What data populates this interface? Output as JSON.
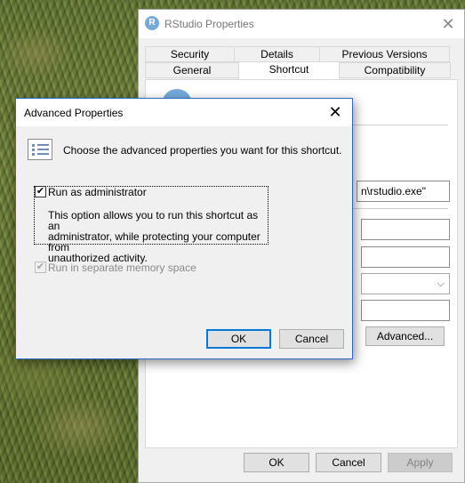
{
  "properties_window": {
    "title": "RStudio Properties",
    "app_icon_letter": "R",
    "tabs_row1": [
      "Security",
      "Details",
      "Previous Versions"
    ],
    "tabs_row2": [
      "General",
      "Shortcut",
      "Compatibility"
    ],
    "active_tab": "Shortcut",
    "target_field_value": "n\\rstudio.exe\"",
    "advanced_button": "Advanced...",
    "ok_button": "OK",
    "cancel_button": "Cancel",
    "apply_button": "Apply"
  },
  "advanced_dialog": {
    "title": "Advanced Properties",
    "prompt": "Choose the advanced properties you want for this shortcut.",
    "run_as_admin": {
      "label": "Run as administrator",
      "checked": true,
      "description_lines": [
        "This option allows you to run this shortcut as an",
        "administrator, while protecting your computer from",
        "unauthorized activity."
      ]
    },
    "separate_memory": {
      "label": "Run in separate memory space",
      "checked": true,
      "disabled": true
    },
    "ok_button": "OK",
    "cancel_button": "Cancel"
  },
  "colors": {
    "accent": "#0078d7",
    "dialog_border": "#2b6cbf",
    "rstudio_blue": "#75aadb"
  }
}
